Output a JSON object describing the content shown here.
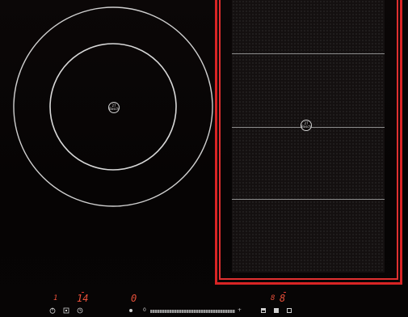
{
  "left_zone": {
    "badge_text": "27\nBosch"
  },
  "bridge_zone": {
    "badge_text": "27\nBosch",
    "accent_color": "#d82424"
  },
  "display": {
    "left_small": "1",
    "left_level": "14",
    "middle_level": "0",
    "right_small": "8",
    "right_level": "8"
  },
  "controls": {
    "icons": [
      "power-icon",
      "childlock-icon",
      "timer-icon"
    ],
    "slider_minus": "−",
    "slider_plus": "+",
    "slider_min_label": "0",
    "slider_max_label": "+"
  }
}
